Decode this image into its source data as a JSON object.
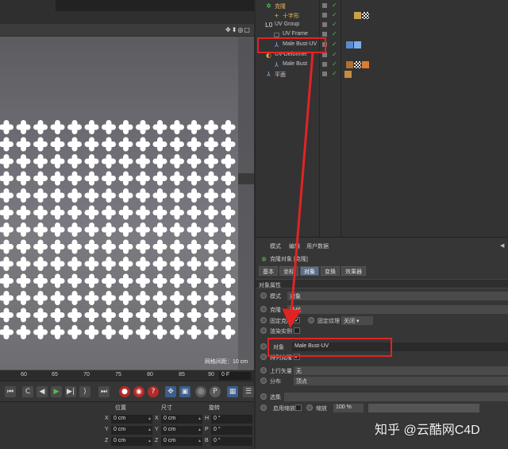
{
  "viewport": {
    "nav_icons": "✥⬍◎▢",
    "scale_label": "网格间距：10 cm",
    "cross_grid": {
      "columns": 14,
      "rows": 13
    }
  },
  "timeline": {
    "ticks": [
      "60",
      "65",
      "70",
      "75",
      "80",
      "85",
      "90"
    ],
    "current_frame": "0 F"
  },
  "transport": {
    "buttons": [
      {
        "name": "go-to-start-icon",
        "glyph": "⏮",
        "style": ""
      },
      {
        "name": "loop-icon",
        "glyph": "C",
        "style": ""
      },
      {
        "name": "step-back-icon",
        "glyph": "◀",
        "style": ""
      },
      {
        "name": "play-icon",
        "glyph": "▶",
        "style": "green"
      },
      {
        "name": "step-forward-icon",
        "glyph": "▶|",
        "style": ""
      },
      {
        "name": "next-key-icon",
        "glyph": "⟩",
        "style": ""
      },
      {
        "name": "go-to-end-icon",
        "glyph": "⏭",
        "style": ""
      },
      {
        "name": "record-icon",
        "glyph": "●",
        "style": "red"
      },
      {
        "name": "autokey-icon",
        "glyph": "◉",
        "style": "red"
      },
      {
        "name": "key-selection-icon",
        "glyph": "?",
        "style": "red"
      },
      {
        "name": "move-key-icon",
        "glyph": "✥",
        "style": "blue"
      },
      {
        "name": "scale-key-icon",
        "glyph": "▣",
        "style": "blue"
      },
      {
        "name": "rotate-key-icon",
        "glyph": "◎",
        "style": "grey"
      },
      {
        "name": "param-key-icon",
        "glyph": "P",
        "style": "grey"
      },
      {
        "name": "pla-key-icon",
        "glyph": "▦",
        "style": "blue"
      },
      {
        "name": "timeline-icon",
        "glyph": "☰",
        "style": ""
      }
    ]
  },
  "coordinates": {
    "headers": [
      "位置",
      "尺寸",
      "旋转"
    ],
    "rows": [
      {
        "axis": "X",
        "pos": "0 cm",
        "size": "0 cm",
        "rot_axis": "H",
        "rot": "0 °"
      },
      {
        "axis": "Y",
        "pos": "0 cm",
        "size": "0 cm",
        "rot_axis": "P",
        "rot": "0 °"
      },
      {
        "axis": "Z",
        "pos": "0 cm",
        "size": "0 cm",
        "rot_axis": "B",
        "rot": "0 °"
      }
    ]
  },
  "object_tree": [
    {
      "name": "克隆",
      "indent": 0,
      "icon": "✲",
      "icon_color": "#5fc85f",
      "text_color": "#e8b25a"
    },
    {
      "name": "十字形",
      "indent": 1,
      "icon": "+",
      "icon_color": "#e0a63a",
      "text_color": "#e8b25a"
    },
    {
      "name": "UV Group",
      "indent": 0,
      "icon": "L0",
      "icon_color": "#dddddd",
      "text_color": "#cccccc"
    },
    {
      "name": "UV Frame",
      "indent": 1,
      "icon": "▢",
      "icon_color": "#bbbbbb",
      "text_color": "#cccccc"
    },
    {
      "name": "Male Bust-UV",
      "indent": 1,
      "icon": "⅄",
      "icon_color": "#8fb4e8",
      "text_color": "#cccccc"
    },
    {
      "name": "UV-Deformer",
      "indent": 0,
      "icon": "◐",
      "icon_color": "#e0a63a",
      "text_color": "#cccccc"
    },
    {
      "name": "Male Bust",
      "indent": 1,
      "icon": "⅄",
      "icon_color": "#8fb4e8",
      "text_color": "#cccccc"
    },
    {
      "name": "平面",
      "indent": 0,
      "icon": "⅄",
      "icon_color": "#8fb4e8",
      "text_color": "#cccccc"
    }
  ],
  "attributes": {
    "menu": [
      "模式",
      "编辑",
      "用户数据"
    ],
    "title": "克隆对象 [克隆]",
    "tabs": [
      {
        "label": "基本",
        "active": false
      },
      {
        "label": "坐标",
        "active": false
      },
      {
        "label": "对象",
        "active": true
      },
      {
        "label": "变换",
        "active": false
      },
      {
        "label": "效果器",
        "active": false
      }
    ],
    "section": "对象属性",
    "mode_label": "模式",
    "mode_value": "对象",
    "clone_label": "克隆",
    "clone_value": "迭代",
    "fixed_clone_label": "固定克隆",
    "fixed_texture_label": "固定纹理",
    "fixed_texture_value": "关闭",
    "render_instance_label": "渲染实例",
    "object_label": "对象",
    "object_value": "Male Bust-UV",
    "arrange_clone_label": "排列克隆",
    "upvector_label": "上行矢量",
    "upvector_value": "无",
    "distribution_label": "分布",
    "distribution_value": "顶点",
    "selection_label": "选集",
    "use_scale_label": "启用缩放",
    "scale_label": "缩放",
    "scale_value": "100 %"
  },
  "watermark": "知乎 @云酷网C4D",
  "colors": {
    "highlight": "#e02424",
    "active_tab": "#5c6f8f",
    "check": "#4cc04a"
  }
}
